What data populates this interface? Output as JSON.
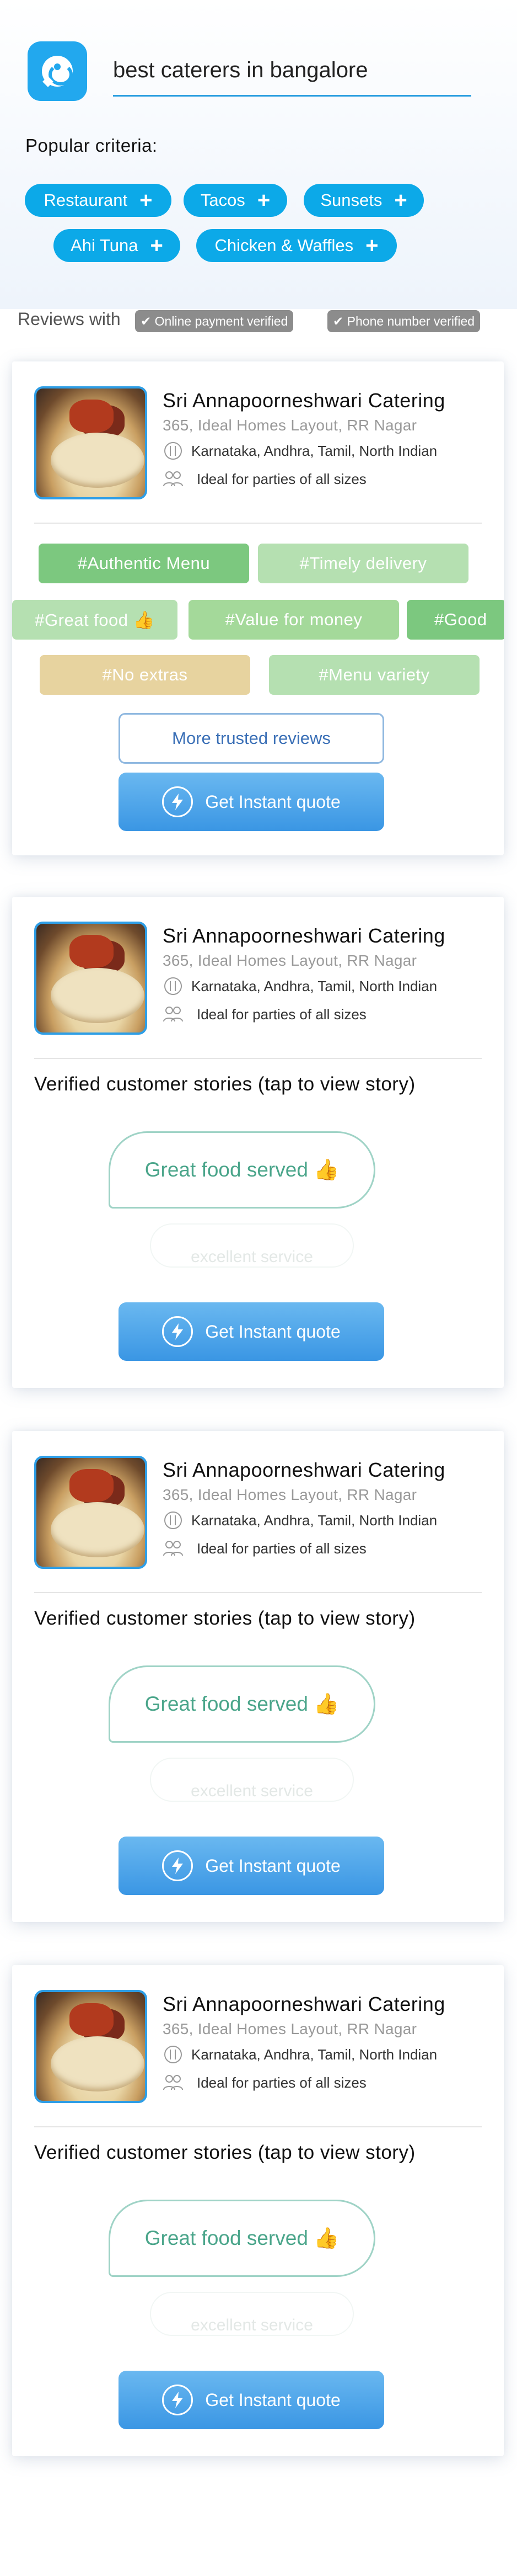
{
  "search": {
    "query": "best caterers in bangalore"
  },
  "popular": {
    "label": "Popular criteria:",
    "chips": [
      "Restaurant",
      "Tacos",
      "Sunsets",
      "Ahi Tuna",
      "Chicken & Waffles"
    ]
  },
  "reviews_with": {
    "label": "Reviews with",
    "badges": [
      "✔ Online payment verified",
      "✔ Phone number verified"
    ]
  },
  "listing": {
    "name": "Sri Annapoorneshwari Catering",
    "address": "365, Ideal Homes Layout, RR Nagar",
    "cuisines": "Karnataka, Andhra, Tamil, North Indian",
    "party": "Ideal for parties of all sizes"
  },
  "tags": [
    "#Authentic Menu",
    "#Timely delivery",
    "#Great food 👍",
    "#Value for money",
    "#Good",
    "#No extras",
    "#Menu variety"
  ],
  "buttons": {
    "more_reviews": "More trusted reviews",
    "quote": "Get Instant quote"
  },
  "stories": {
    "title": "Verified customer stories (tap to view story)",
    "first": "Great food served 👍",
    "second": "excellent service"
  },
  "colors": {
    "accent": "#0ca9e8",
    "button": "#3a96e4",
    "story": "#4aa58a"
  }
}
